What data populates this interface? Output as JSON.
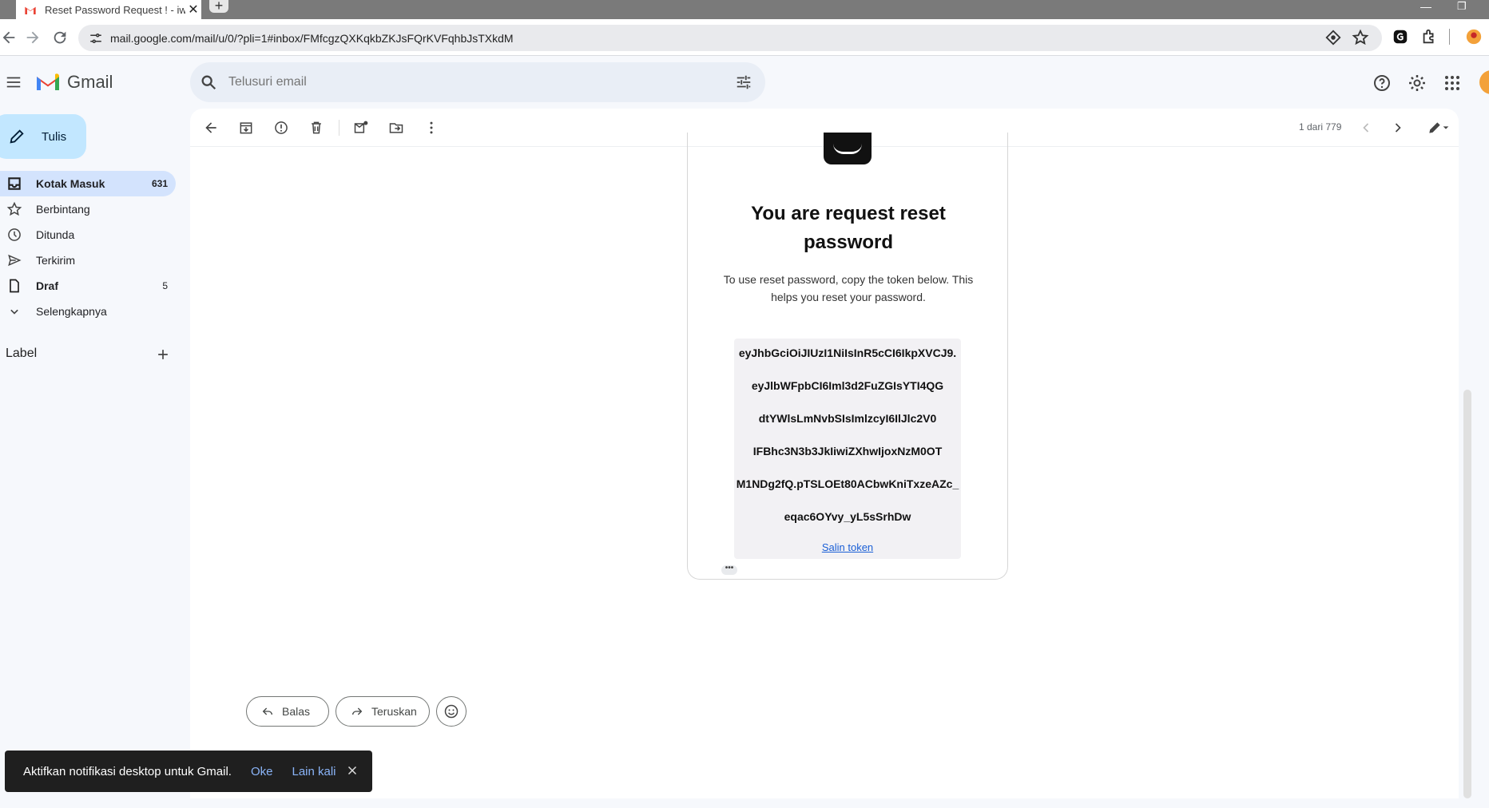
{
  "browser": {
    "tab_title": "Reset Password Request ! - iww",
    "url": "mail.google.com/mail/u/0/?pli=1#inbox/FMfcgzQXKqkbZKJsFQrKVFqhbJsTXkdM"
  },
  "gmail": {
    "logo_text": "Gmail",
    "search_placeholder": "Telusuri email"
  },
  "sidebar": {
    "compose_label": "Tulis",
    "items": [
      {
        "label": "Kotak Masuk",
        "count": "631"
      },
      {
        "label": "Berbintang",
        "count": ""
      },
      {
        "label": "Ditunda",
        "count": ""
      },
      {
        "label": "Terkirim",
        "count": ""
      },
      {
        "label": "Draf",
        "count": "5"
      },
      {
        "label": "Selengkapnya",
        "count": ""
      }
    ],
    "labels_header": "Label"
  },
  "toolbar": {
    "page_info": "1 dari 779"
  },
  "email": {
    "heading_line1": "You are request reset",
    "heading_line2": "password",
    "description": "To use reset password, copy the token below. This helps you reset your password.",
    "token_lines": [
      "eyJhbGciOiJIUzI1NiIsInR5cCI6IkpXVCJ9.",
      "eyJlbWFpbCI6Iml3d2FuZGIsYTI4QG",
      "dtYWlsLmNvbSIsImlzcyI6IlJlc2V0",
      "IFBhc3N3b3JkIiwiZXhwIjoxNzM0OT",
      "M1NDg2fQ.pTSLOEt80ACbwKniTxzeAZc_",
      "eqac6OYvy_yL5sSrhDw"
    ],
    "copy_link": "Salin token"
  },
  "reply": {
    "reply_label": "Balas",
    "forward_label": "Teruskan"
  },
  "snackbar": {
    "message": "Aktifkan notifikasi desktop untuk Gmail.",
    "ok": "Oke",
    "later": "Lain kali"
  }
}
